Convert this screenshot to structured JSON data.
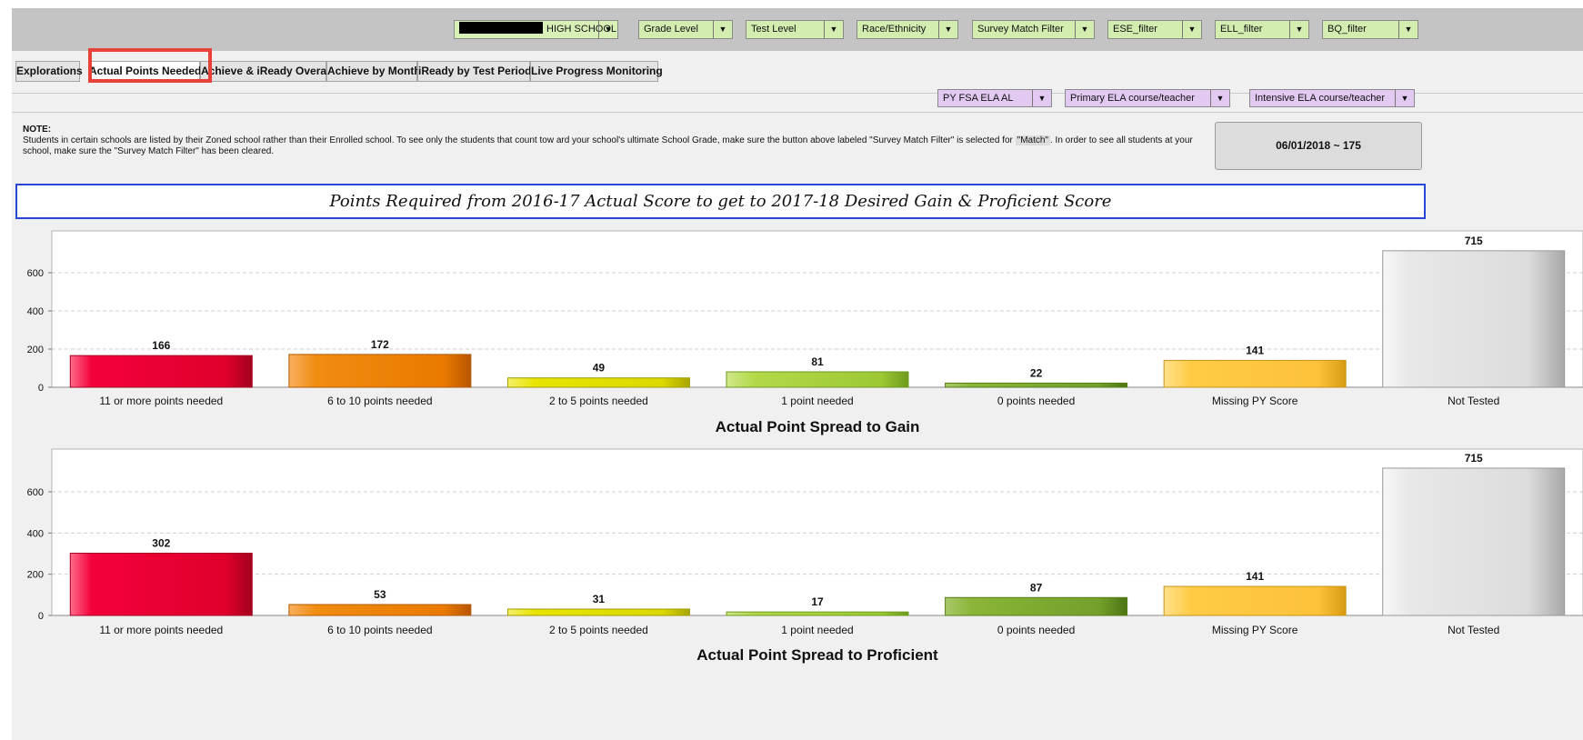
{
  "filters": {
    "school_suffix": "HIGH SCHOOL",
    "grade_level": "Grade Level",
    "test_level": "Test Level",
    "race_ethnicity": "Race/Ethnicity",
    "survey_match": "Survey Match Filter",
    "ese": "ESE_filter",
    "ell": "ELL_filter",
    "bq": "BQ_filter"
  },
  "tabs": [
    {
      "label": "Explorations"
    },
    {
      "label": "Actual Points Needed"
    },
    {
      "label": "Achieve & iReady Overall"
    },
    {
      "label": "Achieve by Month"
    },
    {
      "label": "iReady by Test Period"
    },
    {
      "label": "Live Progress Monitoring"
    }
  ],
  "secondary_filters": {
    "py_fsa": "PY FSA ELA AL",
    "primary_course": "Primary ELA course/teacher",
    "intensive_course": "Intensive ELA course/teacher"
  },
  "note": {
    "heading": "NOTE:",
    "text_a": "Students in certain schools are listed by their Zoned school rather than their Enrolled school. To see only the students that count tow ard your school's ultimate School Grade, make sure the button above labeled \"Survey Match Filter\" is selected for ",
    "match": "\"Match\"",
    "text_b": ". In order to see all students at your school, make sure the \"Survey Match Filter\" has been cleared."
  },
  "date_button": "06/01/2018 ~ 175",
  "banner_title": "Points Required from 2016-17 Actual Score to get to 2017-18 Desired Gain & Proficient Score",
  "colors": {
    "red": "#e8002d",
    "orange": "#ee7a00",
    "yellow": "#e4e000",
    "lightgreen": "#a3cc3a",
    "green": "#7aa52a",
    "gold": "#fec43f",
    "grey": "#e2e2e2"
  },
  "chart_data": [
    {
      "type": "bar",
      "title": "Actual Point Spread to Gain",
      "categories": [
        "11 or more points needed",
        "6 to 10 points needed",
        "2 to 5 points needed",
        "1 point needed",
        "0 points needed",
        "Missing PY Score",
        "Not Tested"
      ],
      "values": [
        166,
        172,
        49,
        81,
        22,
        141,
        715
      ],
      "ylim": [
        0,
        800
      ],
      "yticks": [
        "0",
        "200",
        "400",
        "600"
      ],
      "grid": true
    },
    {
      "type": "bar",
      "title": "Actual Point Spread to Proficient",
      "categories": [
        "11 or more points needed",
        "6 to 10 points needed",
        "2 to 5 points needed",
        "1 point needed",
        "0 points needed",
        "Missing PY Score",
        "Not Tested"
      ],
      "values": [
        302,
        53,
        31,
        17,
        87,
        141,
        715
      ],
      "ylim": [
        0,
        800
      ],
      "yticks": [
        "0",
        "200",
        "400",
        "600"
      ],
      "grid": true
    }
  ]
}
